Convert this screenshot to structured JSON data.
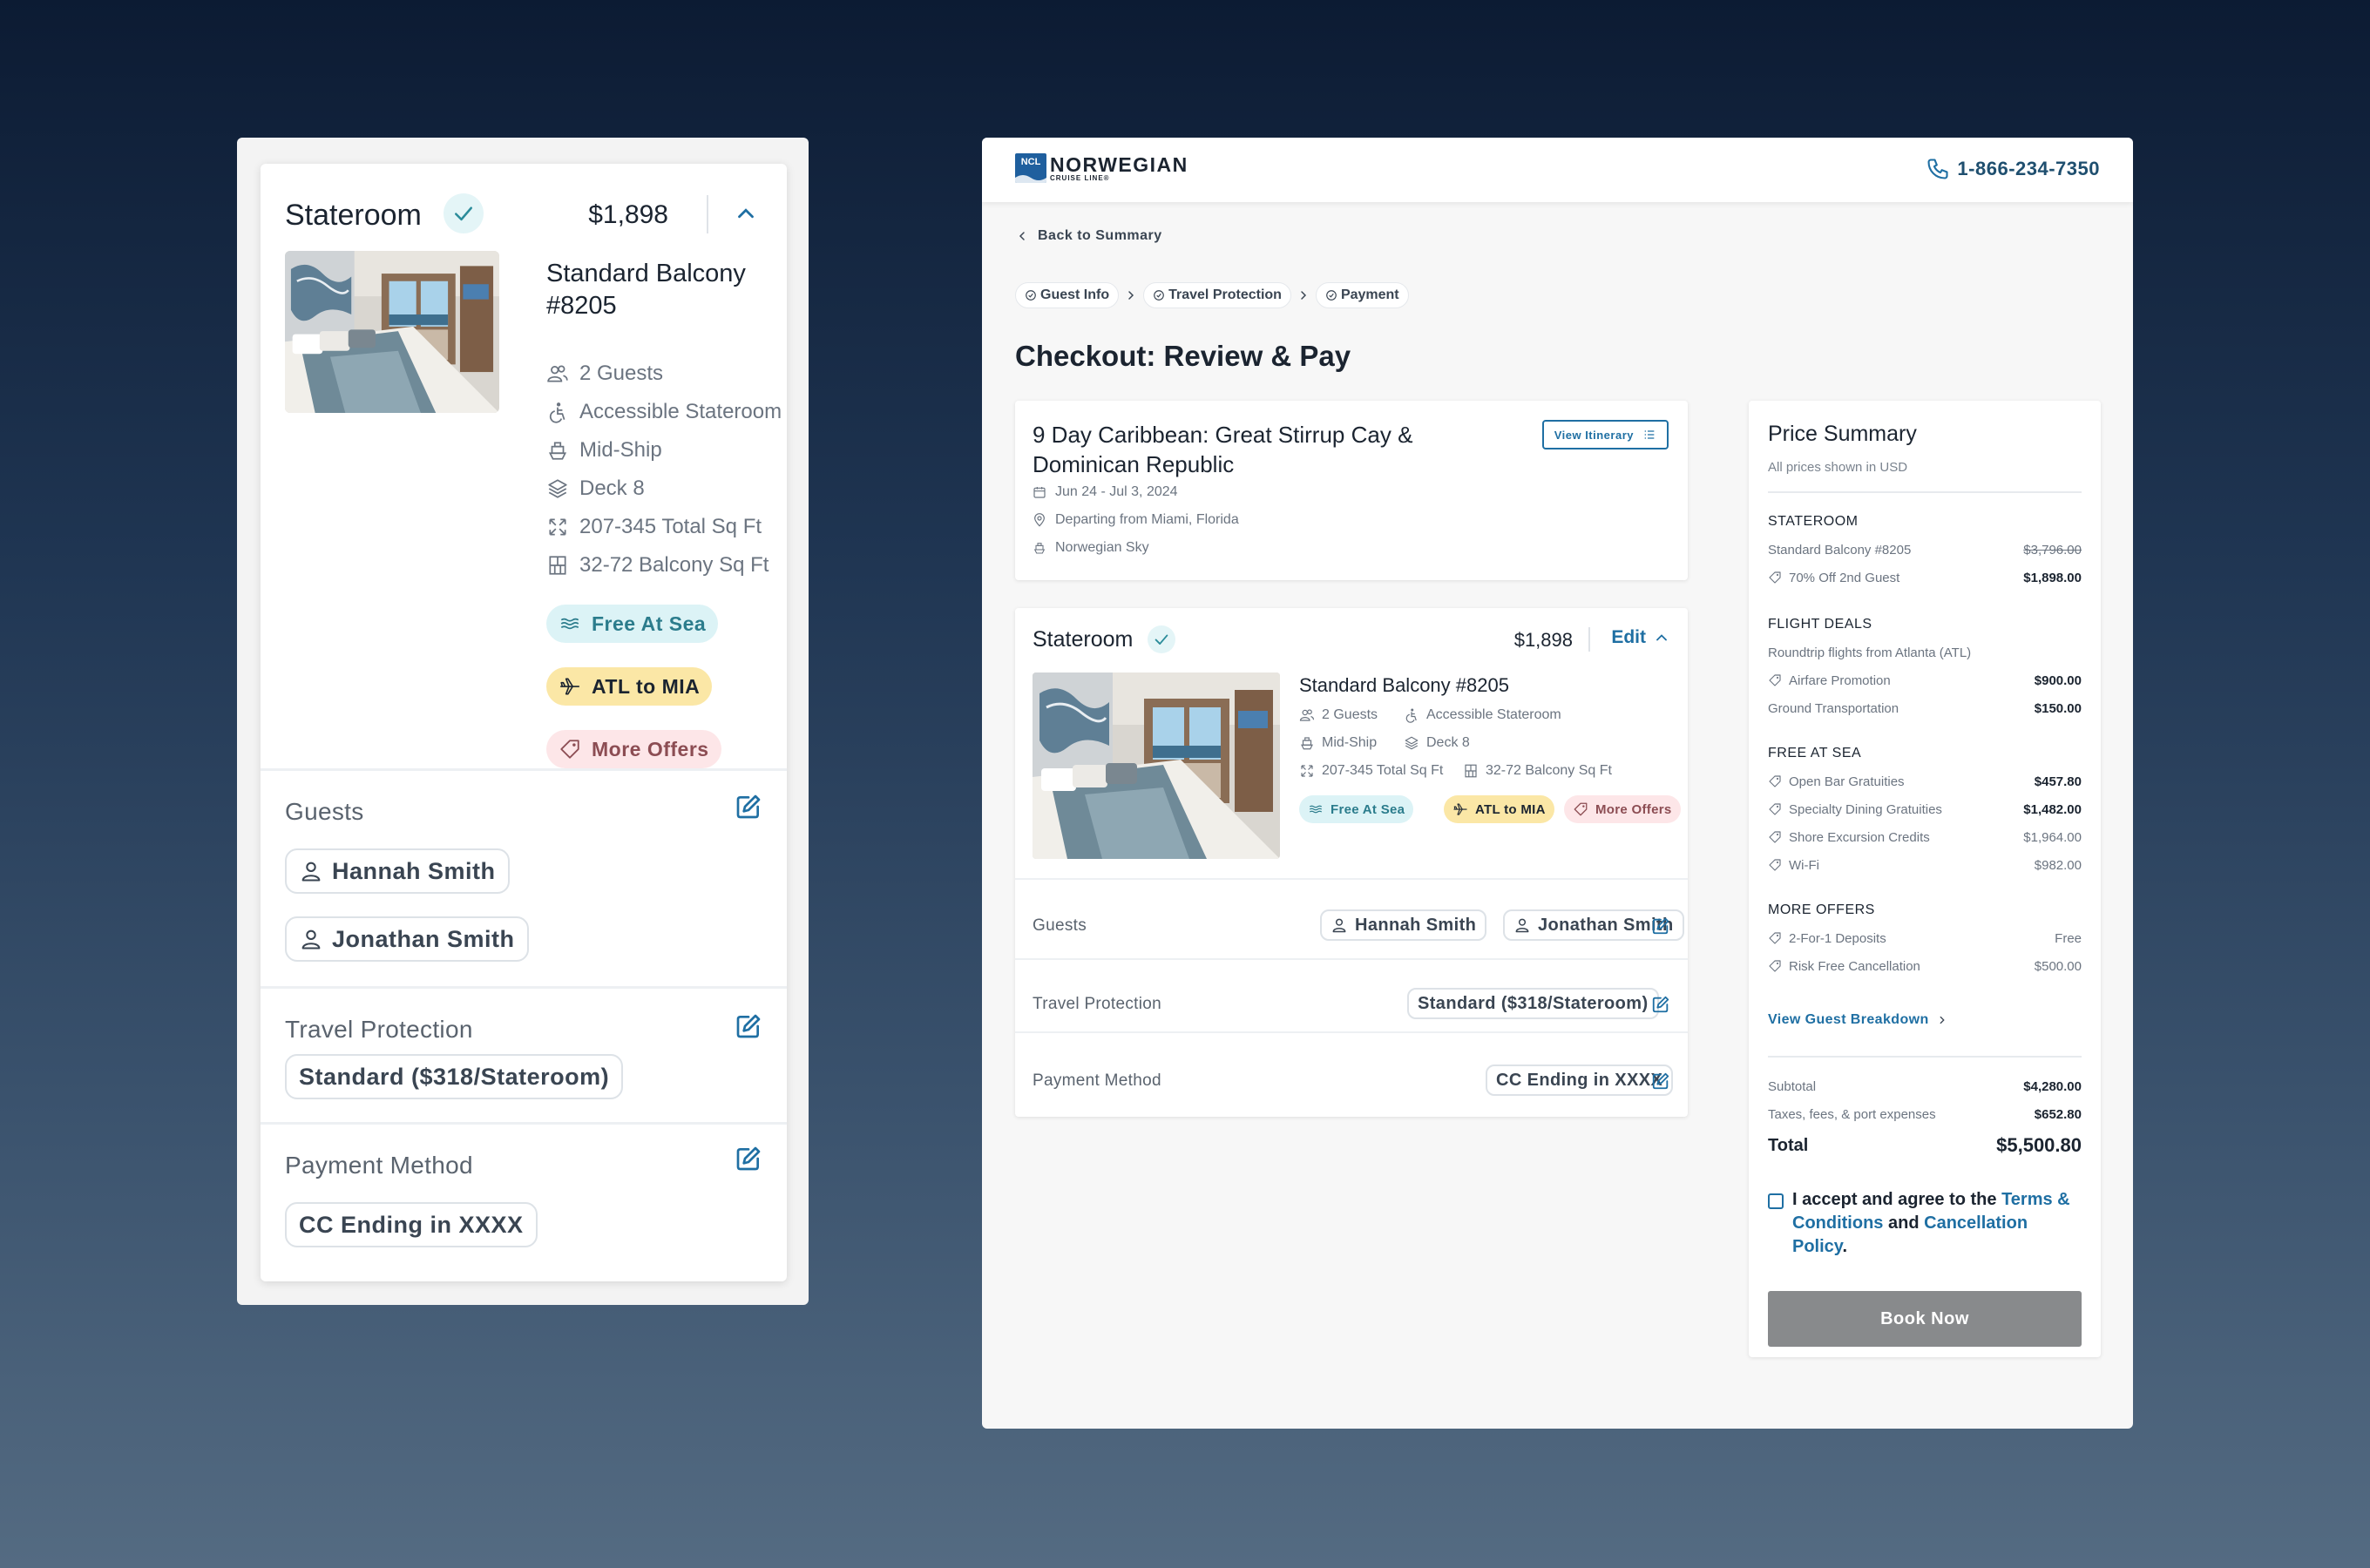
{
  "mobile": {
    "stateroom": {
      "title": "Stateroom",
      "price": "$1,898",
      "room_title": "Standard Balcony #8205",
      "features": [
        {
          "icon": "guests-icon",
          "label": "2 Guests"
        },
        {
          "icon": "accessible-icon",
          "label": "Accessible Stateroom"
        },
        {
          "icon": "ship-icon",
          "label": "Mid-Ship"
        },
        {
          "icon": "deck-icon",
          "label": "Deck 8"
        },
        {
          "icon": "area-icon",
          "label": "207-345 Total Sq Ft"
        },
        {
          "icon": "balcony-icon",
          "label": "32-72 Balcony Sq Ft"
        }
      ],
      "pills": [
        "Free At Sea",
        "ATL to MIA",
        "More Offers"
      ]
    },
    "guests": {
      "label": "Guests",
      "names": [
        "Hannah Smith",
        "Jonathan Smith"
      ]
    },
    "travel_protection": {
      "label": "Travel Protection",
      "value": "Standard ($318/Stateroom)"
    },
    "payment": {
      "label": "Payment Method",
      "value": "CC Ending in XXXX"
    }
  },
  "desktop": {
    "header": {
      "brand": "NORWEGIAN",
      "brand_sub": "CRUISE LINE®",
      "logo_mark": "NCL",
      "phone": "1-866-234-7350"
    },
    "back_link": "Back to Summary",
    "breadcrumbs": [
      "Guest Info",
      "Travel Protection",
      "Payment"
    ],
    "page_title": "Checkout: Review & Pay",
    "trip": {
      "title": "9 Day Caribbean: Great Stirrup Cay & Dominican Republic",
      "itinerary_button": "View Itinerary",
      "dates": "Jun 24 - Jul 3, 2024",
      "departure": "Departing from Miami, Florida",
      "ship": "Norwegian Sky"
    },
    "stateroom": {
      "title": "Stateroom",
      "price": "$1,898",
      "edit_label": "Edit",
      "room_name": "Standard Balcony #8205",
      "features": [
        "2 Guests",
        "Accessible Stateroom",
        "Mid-Ship",
        "Deck 8",
        "207-345 Total Sq Ft",
        "32-72 Balcony Sq Ft"
      ],
      "pills": [
        "Free At Sea",
        "ATL to MIA",
        "More Offers"
      ],
      "guests_label": "Guests",
      "guests": [
        "Hannah Smith",
        "Jonathan Smith"
      ],
      "travel_label": "Travel Protection",
      "travel_value": "Standard ($318/Stateroom)",
      "payment_label": "Payment Method",
      "payment_value": "CC Ending in XXXX"
    },
    "summary": {
      "title": "Price Summary",
      "subtitle": "All prices shown in USD",
      "stateroom": {
        "heading": "STATEROOM",
        "room": "Standard Balcony #8205",
        "room_price": "$3,796.00",
        "discount": "70% Off 2nd Guest",
        "discount_price": "$1,898.00"
      },
      "flights": {
        "heading": "FLIGHT DEALS",
        "route": "Roundtrip flights from Atlanta (ATL)",
        "airfare": "Airfare Promotion",
        "airfare_price": "$900.00",
        "ground": "Ground Transportation",
        "ground_price": "$150.00"
      },
      "free_at_sea": {
        "heading": "FREE AT SEA",
        "items": [
          {
            "label": "Open Bar Gratuities",
            "price": "$457.80",
            "bold": true
          },
          {
            "label": "Specialty Dining Gratuities",
            "price": "$1,482.00",
            "bold": true
          },
          {
            "label": "Shore Excursion Credits",
            "price": "$1,964.00",
            "bold": false
          },
          {
            "label": "Wi-Fi",
            "price": "$982.00",
            "bold": false
          }
        ]
      },
      "more_offers": {
        "heading": "MORE OFFERS",
        "items": [
          {
            "label": "2-For-1 Deposits",
            "price": "Free"
          },
          {
            "label": "Risk Free Cancellation",
            "price": "$500.00"
          }
        ]
      },
      "breakdown_link": "View Guest Breakdown",
      "subtotal_label": "Subtotal",
      "subtotal": "$4,280.00",
      "taxes_label": "Taxes, fees, & port expenses",
      "taxes": "$652.80",
      "total_label": "Total",
      "total": "$5,500.80",
      "agree_prefix": "I accept and agree to the",
      "terms_link": "Terms & Conditions",
      "and": "and",
      "cancel_link": "Cancellation Policy",
      "period": ".",
      "book_button": "Book Now"
    }
  },
  "colors": {
    "accent_blue": "#1f6fa3",
    "sea_pill": "#dcf3f6",
    "flight_pill": "#fbe7a6",
    "offer_pill": "#fde6e8",
    "book_button": "#888a8c"
  }
}
